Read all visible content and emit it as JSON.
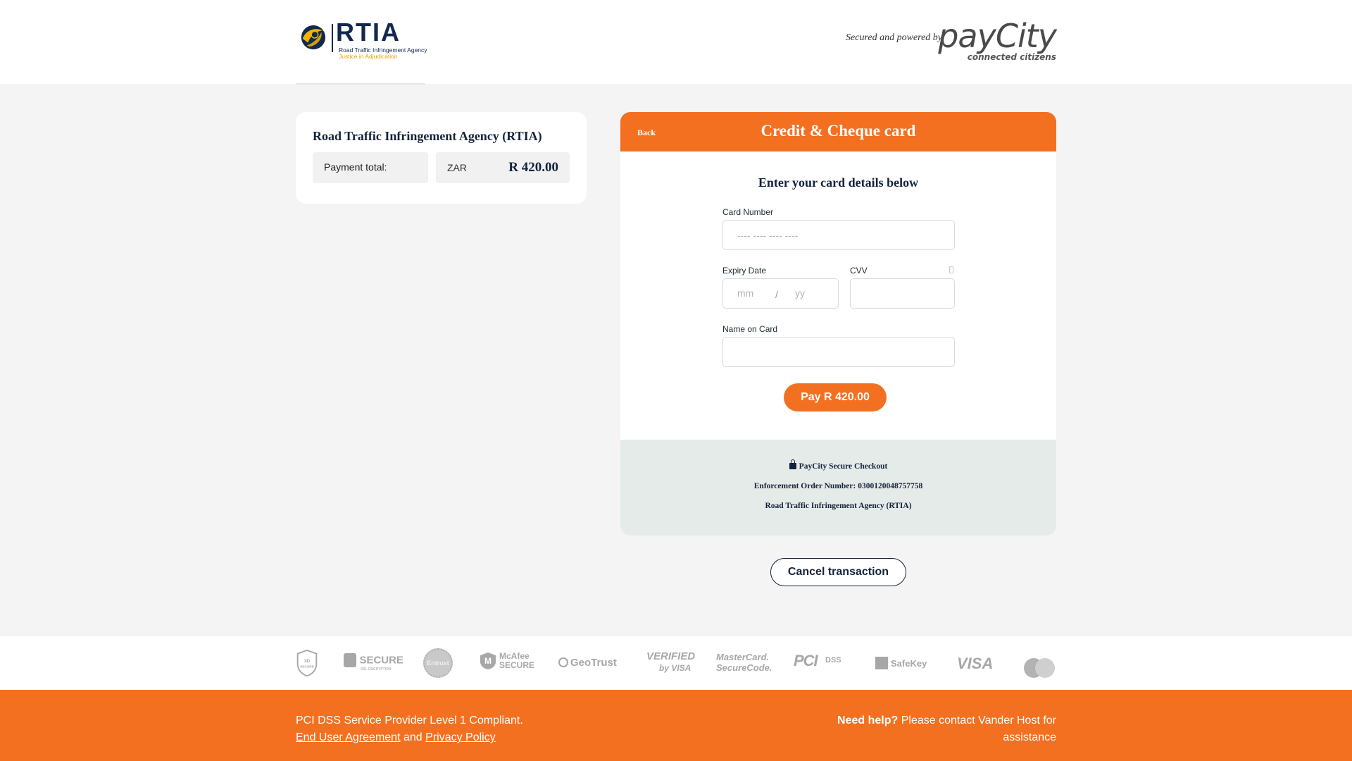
{
  "header": {
    "logo_name": "RTIA",
    "logo_subtitle": "Road Traffic Infringement Agency",
    "logo_tagline": "Justice in Adjudication",
    "powered_text": "Secured and powered by",
    "paycity_word": "payCity",
    "paycity_tagline": "connected citizens"
  },
  "summary": {
    "title": "Road Traffic Infringement Agency (RTIA)",
    "payment_label": "Payment total:",
    "currency": "ZAR",
    "amount": "R 420.00"
  },
  "payment": {
    "back_label": "Back",
    "title": "Credit & Cheque card",
    "form_title": "Enter your card details below",
    "card_number_label": "Card Number",
    "card_number_placeholder": "---- ---- ---- ----",
    "expiry_label": "Expiry Date",
    "expiry_month_placeholder": "mm",
    "expiry_separator": "/",
    "expiry_year_placeholder": "yy",
    "cvv_label": "CVV",
    "name_label": "Name on Card",
    "pay_button": "Pay R 420.00",
    "secure_checkout": "PayCity Secure Checkout",
    "enforcement_order": "Enforcement Order Number: 0300120048757758",
    "agency": "Road Traffic Infringement Agency (RTIA)"
  },
  "cancel_button": "Cancel transaction",
  "badges": {
    "three_d": "3D SECURE",
    "secure": "SECURE",
    "secure_sub": "SSL ENCRYPTION",
    "entrust": "Entrust",
    "mcafee": "McAfee",
    "mcafee_sub": "SECURE",
    "geotrust": "GeoTrust",
    "verified": "VERIFIED",
    "verified_sub": "by VISA",
    "mastercard": "MasterCard.",
    "mastercard_sub": "SecureCode.",
    "pci": "PCI",
    "pci_sub": "DSS",
    "safekey": "SafeKey",
    "visa": "VISA"
  },
  "footer": {
    "compliance": "PCI DSS Service Provider Level 1 Compliant.",
    "agreement_link": "End User Agreement",
    "and": "and",
    "privacy_link": "Privacy Policy",
    "help_bold": "Need help?",
    "help_text": "Please contact Vander Host for assistance"
  },
  "colors": {
    "accent": "#f37021",
    "navy": "#14233b",
    "footer_panel": "#e5ebe9"
  }
}
